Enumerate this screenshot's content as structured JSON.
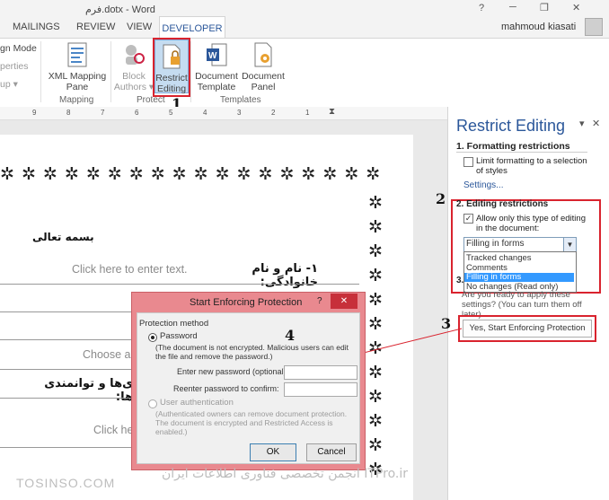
{
  "window": {
    "title": "فرم.dotx - Word",
    "user": "mahmoud kiasati",
    "help": "?",
    "minimize": "─",
    "restore": "❐",
    "close": "✕"
  },
  "tabs": {
    "mailings": "MAILINGS",
    "review": "REVIEW",
    "view": "VIEW",
    "developer": "DEVELOPER"
  },
  "ribbon": {
    "partial_design_mode": "gn Mode",
    "partial_properties": "perties",
    "partial_group": "up ▾",
    "xml_mapping": "XML Mapping",
    "xml_mapping2": "Pane",
    "block_authors": "Block",
    "block_authors2": "Authors ▾",
    "restrict_editing": "Restrict",
    "restrict_editing2": "Editing",
    "document_template": "Document",
    "document_template2": "Template",
    "document_panel": "Document",
    "document_panel2": "Panel",
    "group_mapping": "Mapping",
    "group_protect": "Protect",
    "group_templates": "Templates"
  },
  "ruler": {
    "ticks": [
      "1",
      "2",
      "3",
      "4",
      "5",
      "6",
      "7",
      "8",
      "9"
    ]
  },
  "doc": {
    "besmeh": "بسمه تعالی",
    "field1_label": "۱-  نام و نام خانوادگی:",
    "field1_placeholder": "Click here to enter text.",
    "choose_placeholder": "Choose a",
    "field2_label": "ی‌ها و توانمندی ها:",
    "click_placeholder": "Click he"
  },
  "pane": {
    "title": "Restrict Editing",
    "pin": "▾",
    "close": "✕",
    "section1": "1. Formatting restrictions",
    "limit_formatting": "Limit formatting to a selection of styles",
    "settings_link": "Settings...",
    "section2": "2. Editing restrictions",
    "allow_only": "Allow only this type of editing in the document:",
    "dropdown_value": "Filling in forms",
    "options": [
      "Tracked changes",
      "Comments",
      "Filling in forms",
      "No changes (Read only)"
    ],
    "section3": "3.",
    "ready_text": "Are you ready to apply these settings? (You can turn them off later)",
    "start_button": "Yes, Start Enforcing Protection"
  },
  "annotations": {
    "n1": "1",
    "n2": "2",
    "n3": "3",
    "n4": "4"
  },
  "dialog": {
    "title": "Start Enforcing Protection",
    "help": "?",
    "close": "✕",
    "group": "Protection method",
    "password": "Password",
    "password_desc": "(The document is not encrypted. Malicious users can edit the file and remove the password.)",
    "new_password": "Enter new password (optional):",
    "confirm_password": "Reenter password to confirm:",
    "user_auth": "User authentication",
    "user_auth_desc": "(Authenticated owners can remove document protection. The document is encrypted and Restricted Access is enabled.)",
    "ok": "OK",
    "cancel": "Cancel"
  },
  "watermark": {
    "left": "TOSINSO.COM",
    "right": "انجمن تخصصی فناوری اطلاعات ایران ITPro.ir"
  },
  "colors": {
    "accent": "#2b579a",
    "red": "#d9232e",
    "dialog_title": "#e9898f",
    "selected": "#3399ff"
  }
}
